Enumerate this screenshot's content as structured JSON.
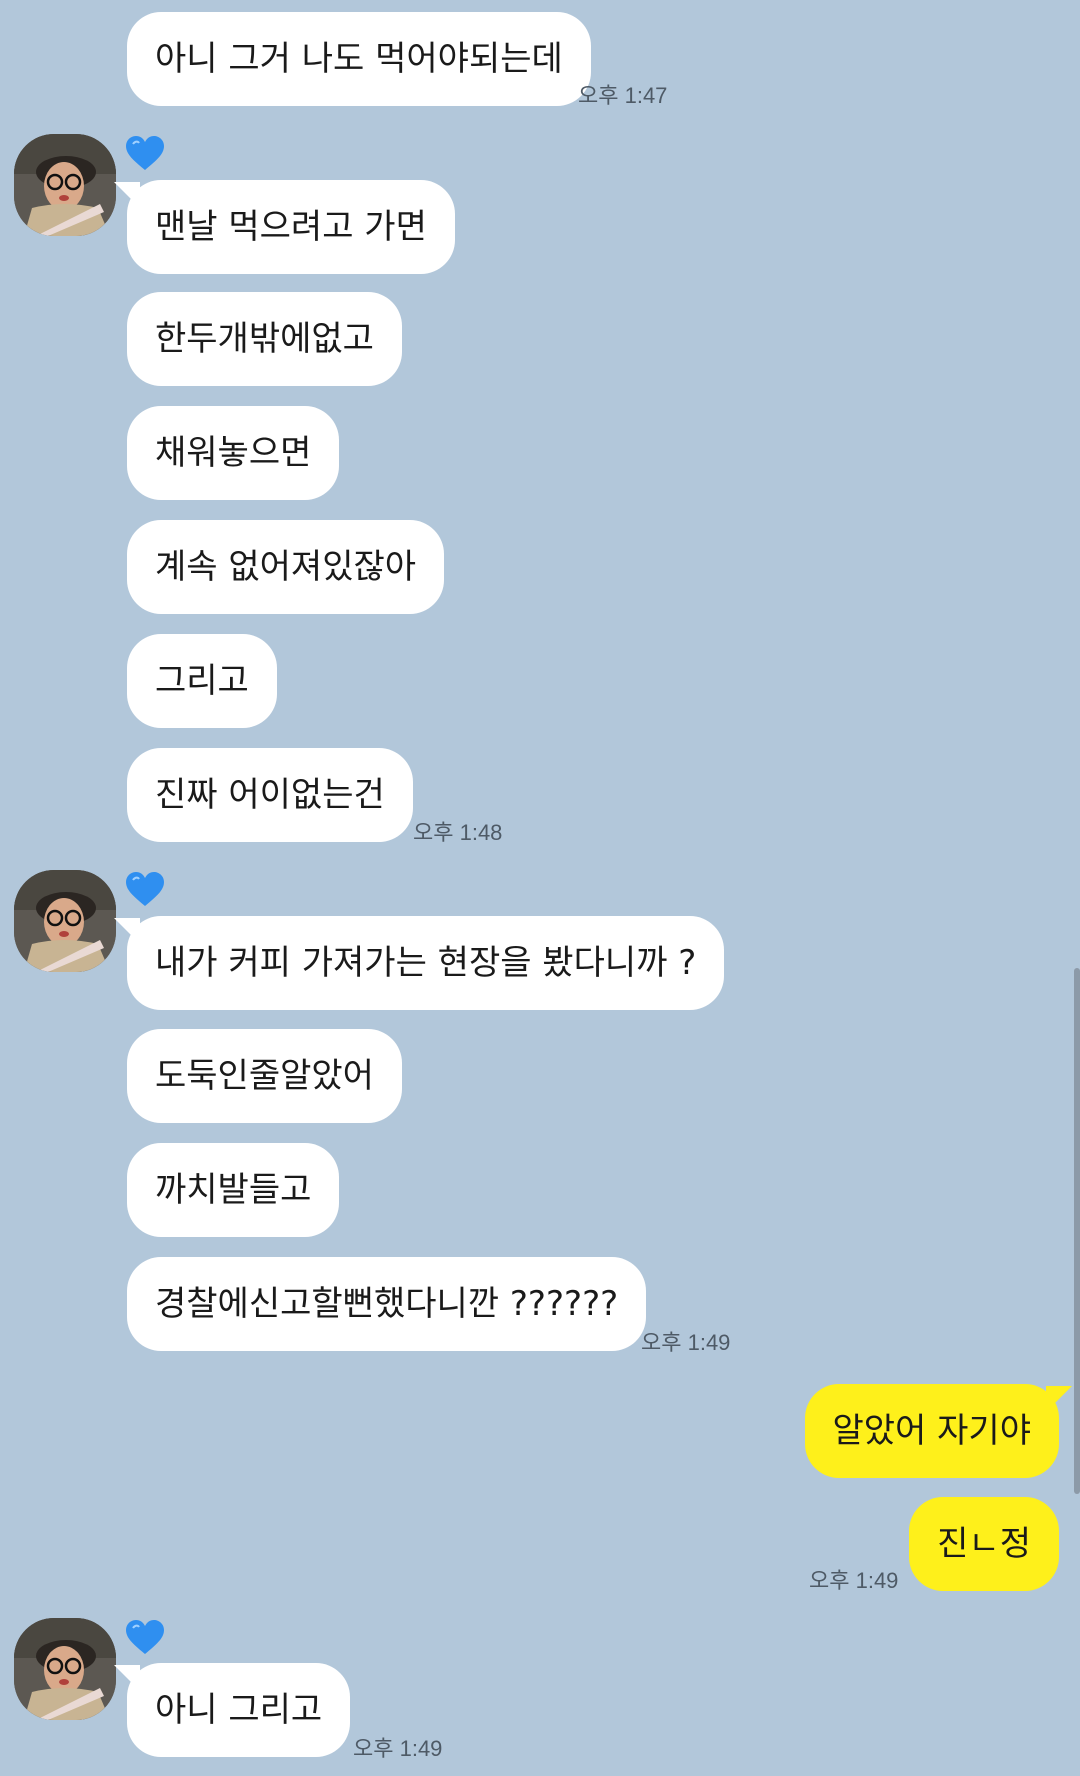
{
  "messages": {
    "m1": "아니 그거 나도 먹어야되는데",
    "m2": "맨날 먹으려고 가면",
    "m3": "한두개밖에없고",
    "m4": "채워놓으면",
    "m5": "계속 없어져있잖아",
    "m6": "그리고",
    "m7": "진짜 어이없는건",
    "m8": "내가 커피 가져가는 현장을 봤다니까 ?",
    "m9": "도둑인줄알았어",
    "m10": "까치발들고",
    "m11": "경찰에신고할뻔했다니깐 ??????",
    "m12": "알았어 자기야",
    "m13": "진ㄴ정",
    "m14": "아니 그리고"
  },
  "times": {
    "t1": "오후 1:47",
    "t2": "오후 1:48",
    "t3": "오후 1:49",
    "t4": "오후 1:49",
    "t5": "오후 1:49"
  },
  "colors": {
    "background": "#b2c7da",
    "incoming_bubble": "#ffffff",
    "outgoing_bubble": "#fef01b",
    "heart": "#2f8ff0"
  },
  "icons": {
    "sender_badge": "blue-heart-icon",
    "avatar": "profile-avatar"
  }
}
